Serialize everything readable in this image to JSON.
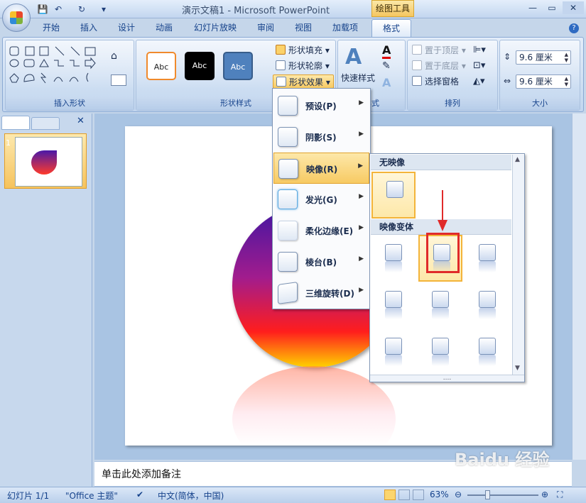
{
  "window": {
    "title": "演示文稿1 - Microsoft PowerPoint",
    "tool_tab": "绘图工具",
    "minimize": "—",
    "restore": "▭",
    "close": "✕"
  },
  "qat": {
    "save": "💾",
    "undo": "↶",
    "redo": "↻",
    "more": "▾"
  },
  "tabs": [
    "开始",
    "插入",
    "设计",
    "动画",
    "幻灯片放映",
    "审阅",
    "视图",
    "加载项"
  ],
  "active_tab": "格式",
  "ribbon": {
    "insert_shapes_label": "插入形状",
    "shape_styles_label": "形状样式",
    "style_samples": [
      "Abc",
      "Abc",
      "Abc"
    ],
    "fill": "形状填充",
    "outline": "形状轮廓",
    "effects": "形状效果",
    "quick_styles": "快速样式",
    "wordart_label": "样式",
    "bring_front": "置于顶层",
    "send_back": "置于底层",
    "selection_pane": "选择窗格",
    "arrange_label": "排列",
    "height": "9.6 厘米",
    "width": "9.6 厘米",
    "size_label": "大小"
  },
  "effects_menu": [
    {
      "label": "预设(P)"
    },
    {
      "label": "阴影(S)"
    },
    {
      "label": "映像(R)"
    },
    {
      "label": "发光(G)"
    },
    {
      "label": "柔化边缘(E)"
    },
    {
      "label": "棱台(B)"
    },
    {
      "label": "三维旋转(D)"
    }
  ],
  "reflection_gallery": {
    "none_header": "无映像",
    "variants_header": "映像变体",
    "more": "....",
    "selected_variant_index": 1
  },
  "slides_panel": {
    "slide_number": "1"
  },
  "notes_placeholder": "单击此处添加备注",
  "status": {
    "slide": "幻灯片 1/1",
    "theme": "\"Office 主题\"",
    "language": "中文(简体，中国)",
    "zoom": "63%"
  },
  "watermark": "Baidu 经验",
  "colors": {
    "accent": "#f7ca63",
    "highlight": "#e02a2a",
    "ribbon": "#cadcf1"
  }
}
